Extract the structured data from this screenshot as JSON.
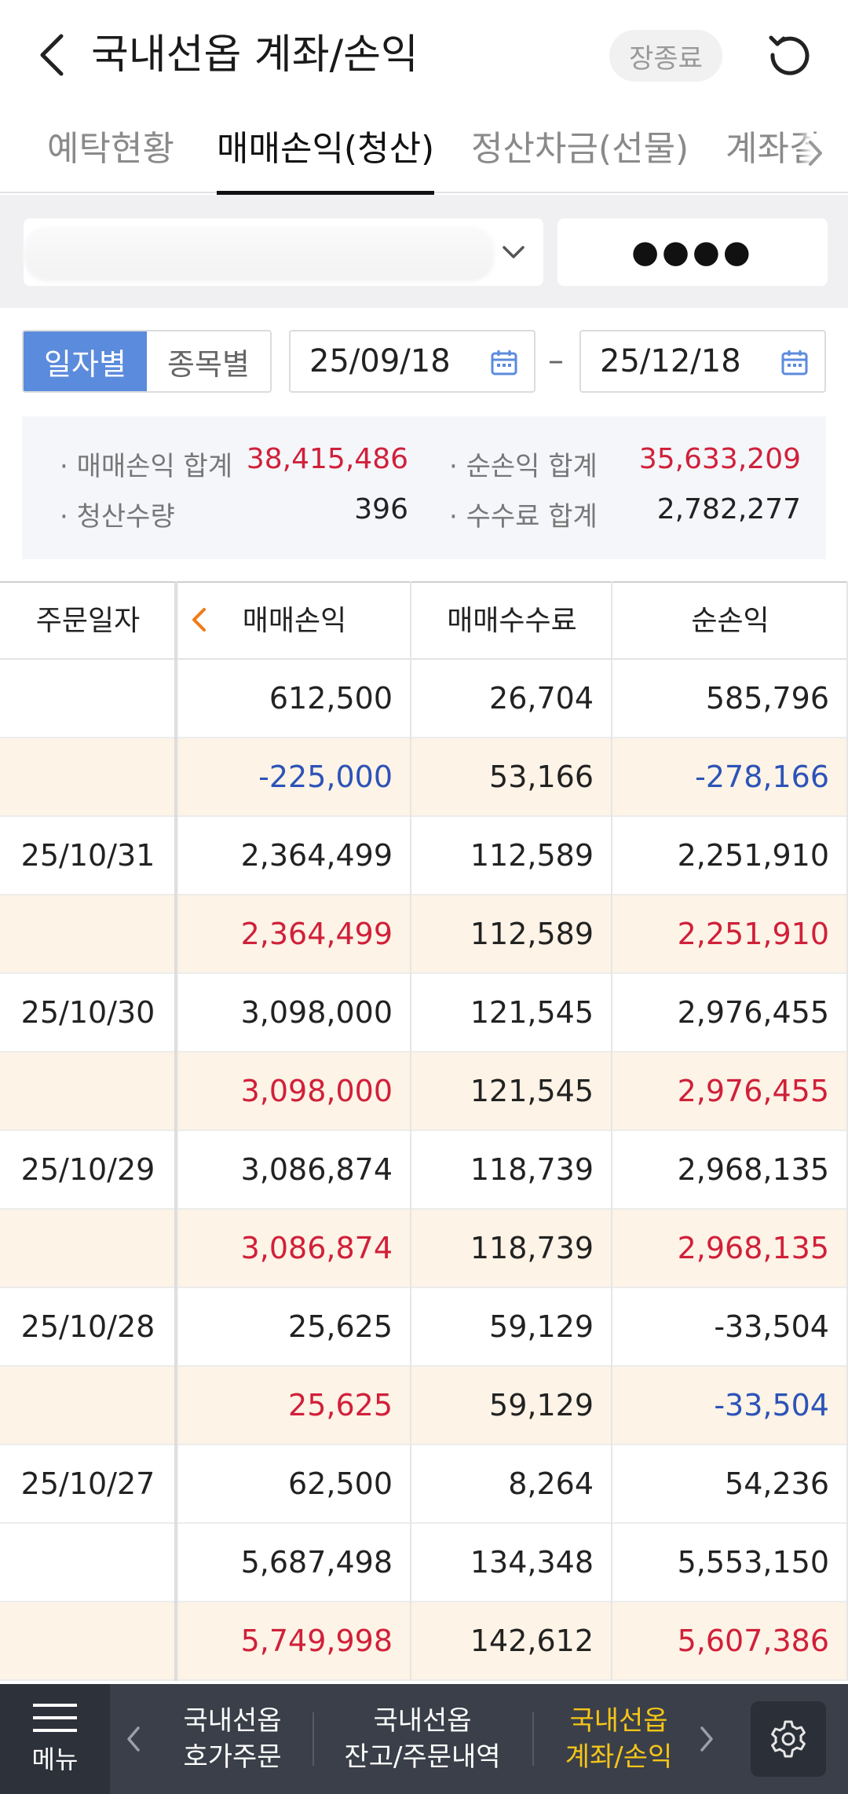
{
  "header": {
    "title": "국내선옵 계좌/손익",
    "close_label": "장종료"
  },
  "tabs": [
    {
      "label": "예탁현황",
      "active": false
    },
    {
      "label": "매매손익(청산)",
      "active": true
    },
    {
      "label": "정산차금(선물)",
      "active": false
    },
    {
      "label": "계좌결",
      "active": false
    }
  ],
  "account": {
    "password_mask": "●●●●"
  },
  "filter": {
    "by_date_label": "일자별",
    "by_item_label": "종목별",
    "selected": "일자별",
    "start_date": "25/09/18",
    "end_date": "25/12/18",
    "date_separator": "–"
  },
  "summary": {
    "trade_pl_label": "· 매매손익 합계",
    "trade_pl_value": "38,415,486",
    "net_pl_label": "· 순손익 합계",
    "net_pl_value": "35,633,209",
    "settle_qty_label": "· 청산수량",
    "settle_qty_value": "396",
    "fee_label": "· 수수료 합계",
    "fee_value": "2,782,277"
  },
  "table": {
    "headers": [
      "주문일자",
      "매매손익",
      "매매수수료",
      "순손익"
    ],
    "rows": [
      {
        "date": "",
        "pl": "612,500",
        "fee": "26,704",
        "net": "585,796",
        "subtotal": false,
        "pl_color": "",
        "net_color": ""
      },
      {
        "date": "",
        "pl": "-225,000",
        "fee": "53,166",
        "net": "-278,166",
        "subtotal": true,
        "pl_color": "blue",
        "net_color": "blue"
      },
      {
        "date": "25/10/31",
        "pl": "2,364,499",
        "fee": "112,589",
        "net": "2,251,910",
        "subtotal": false,
        "pl_color": "",
        "net_color": ""
      },
      {
        "date": "",
        "pl": "2,364,499",
        "fee": "112,589",
        "net": "2,251,910",
        "subtotal": true,
        "pl_color": "red",
        "net_color": "red"
      },
      {
        "date": "25/10/30",
        "pl": "3,098,000",
        "fee": "121,545",
        "net": "2,976,455",
        "subtotal": false,
        "pl_color": "",
        "net_color": ""
      },
      {
        "date": "",
        "pl": "3,098,000",
        "fee": "121,545",
        "net": "2,976,455",
        "subtotal": true,
        "pl_color": "red",
        "net_color": "red"
      },
      {
        "date": "25/10/29",
        "pl": "3,086,874",
        "fee": "118,739",
        "net": "2,968,135",
        "subtotal": false,
        "pl_color": "",
        "net_color": ""
      },
      {
        "date": "",
        "pl": "3,086,874",
        "fee": "118,739",
        "net": "2,968,135",
        "subtotal": true,
        "pl_color": "red",
        "net_color": "red"
      },
      {
        "date": "25/10/28",
        "pl": "25,625",
        "fee": "59,129",
        "net": "-33,504",
        "subtotal": false,
        "pl_color": "",
        "net_color": ""
      },
      {
        "date": "",
        "pl": "25,625",
        "fee": "59,129",
        "net": "-33,504",
        "subtotal": true,
        "pl_color": "red",
        "net_color": "blue"
      },
      {
        "date": "25/10/27",
        "pl": "62,500",
        "fee": "8,264",
        "net": "54,236",
        "subtotal": false,
        "pl_color": "",
        "net_color": ""
      },
      {
        "date": "",
        "pl": "5,687,498",
        "fee": "134,348",
        "net": "5,553,150",
        "subtotal": false,
        "pl_color": "",
        "net_color": ""
      },
      {
        "date": "",
        "pl": "5,749,998",
        "fee": "142,612",
        "net": "5,607,386",
        "subtotal": true,
        "pl_color": "red",
        "net_color": "red"
      }
    ]
  },
  "bottom_nav": {
    "menu_label": "메뉴",
    "items": [
      {
        "line1": "국내선옵",
        "line2": "호가주문",
        "active": false
      },
      {
        "line1": "국내선옵",
        "line2": "잔고/주문내역",
        "active": false
      },
      {
        "line1": "국내선옵",
        "line2": "계좌/손익",
        "active": true
      }
    ]
  },
  "colors": {
    "positive": "#d0203a",
    "negative": "#2c53b8",
    "accent": "#5b8bdc",
    "active_nav": "#f5c518",
    "subtotal_bg": "#fdf3e6"
  }
}
